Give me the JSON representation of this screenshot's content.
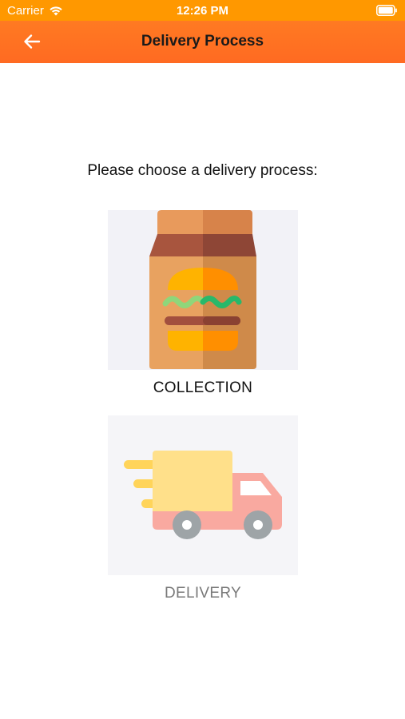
{
  "status_bar": {
    "carrier": "Carrier",
    "time": "12:26 PM",
    "icons": [
      "wifi-icon",
      "battery-icon"
    ]
  },
  "app_bar": {
    "title": "Delivery Process",
    "back_icon": "arrow-left-icon",
    "color": "#ff6d22"
  },
  "content": {
    "prompt": "Please choose a delivery process:",
    "options": [
      {
        "label": "COLLECTION",
        "icon": "burger-bag-icon"
      },
      {
        "label": "DELIVERY",
        "icon": "delivery-truck-icon"
      }
    ]
  },
  "colors": {
    "status_bar": "#ff9800",
    "app_bar": "#ff6d22"
  }
}
